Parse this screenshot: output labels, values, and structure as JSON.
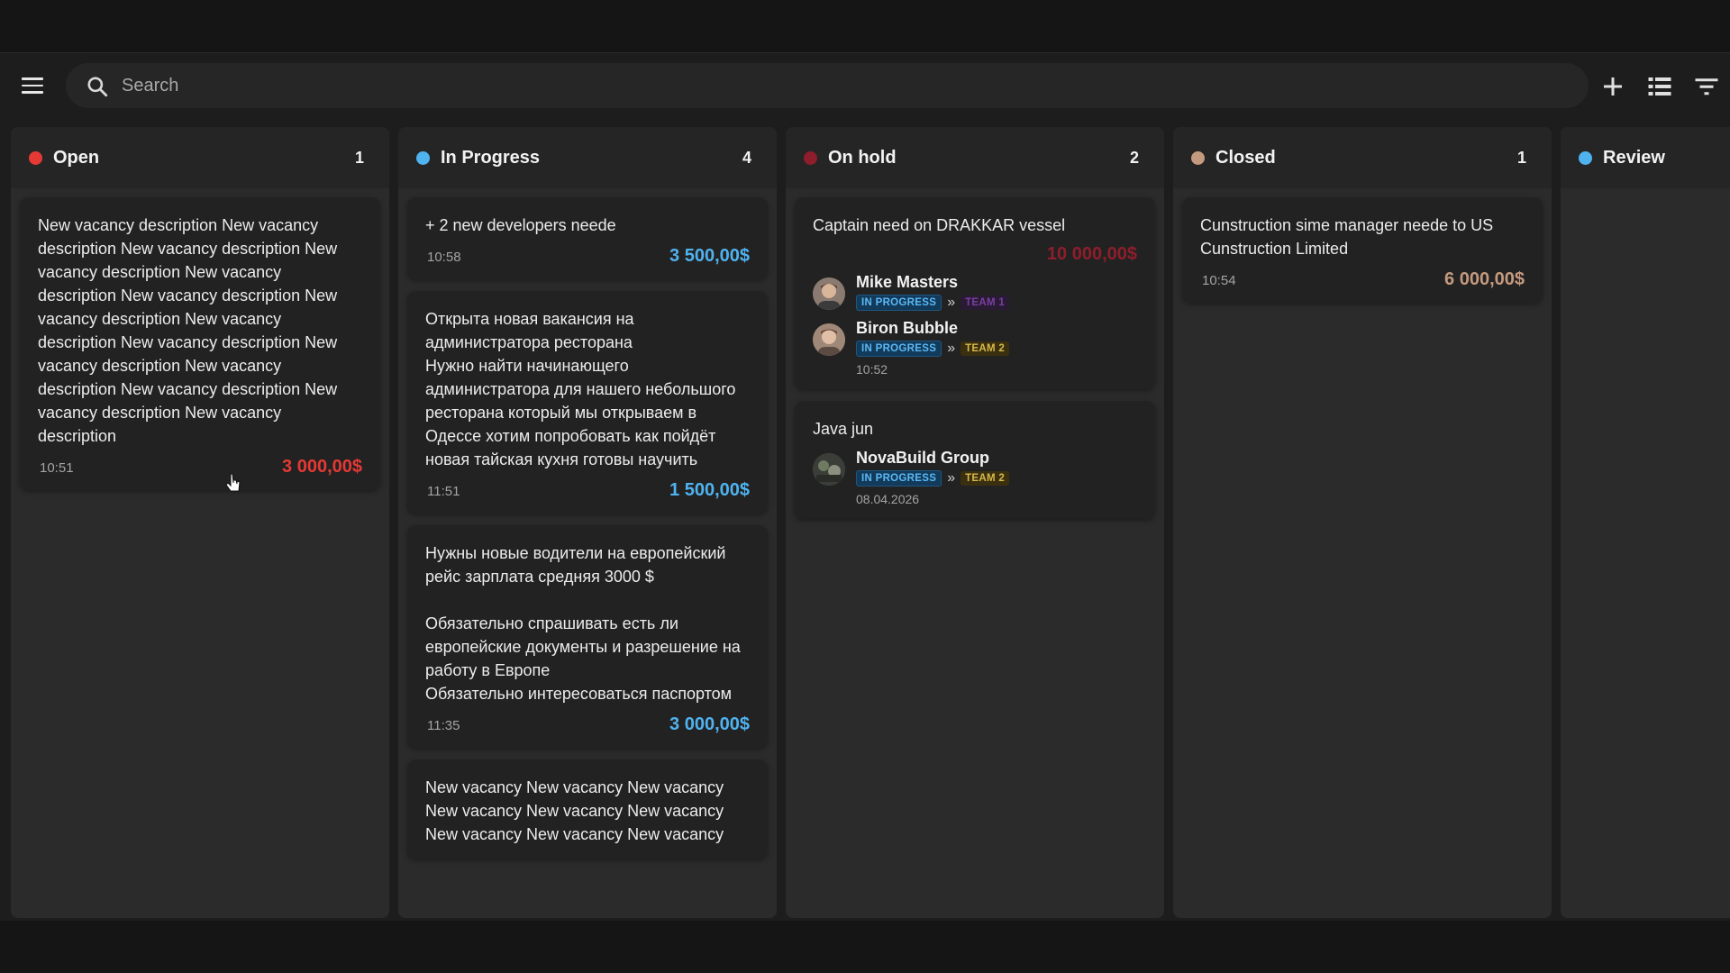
{
  "search": {
    "placeholder": "Search"
  },
  "colors": {
    "open": "#e53935",
    "in_progress": "#4fb3f0",
    "on_hold": "#8e1e2c",
    "closed": "#c49a7e",
    "review": "#4fb3f0"
  },
  "columns": [
    {
      "title": "Open",
      "count": "1",
      "cards": [
        {
          "text": "New vacancy description New vacancy description New vacancy description New vacancy description New vacancy description New vacancy description New vacancy description New vacancy description New vacancy description New vacancy description New vacancy description New vacancy description New vacancy description New vacancy description",
          "time": "10:51",
          "amount": "3 000,00$"
        }
      ]
    },
    {
      "title": "In Progress",
      "count": "4",
      "cards": [
        {
          "text": "+ 2 new developers neede",
          "time": "10:58",
          "amount": "3 500,00$"
        },
        {
          "text": "Открыта новая вакансия на администратора ресторана\nНужно найти начинающего администратора для нашего небольшого ресторана который мы открываем в Одессе хотим попробовать как пойдёт новая тайская кухня готовы научить",
          "time": "11:51",
          "amount": "1 500,00$"
        },
        {
          "text": "Нужны новые водители на европейский рейс зарплата средняя 3000 $\n\nОбязательно спрашивать есть ли европейские документы и разрешение на работу в Европе\nОбязательно интересоваться паспортом",
          "time": "11:35",
          "amount": "3 000,00$"
        },
        {
          "text": "New vacancy New vacancy New vacancy New vacancy New vacancy New vacancy New vacancy New vacancy New vacancy"
        }
      ]
    },
    {
      "title": "On hold",
      "count": "2",
      "cards": [
        {
          "text": "Captain need on DRAKKAR vessel",
          "amount": "10 000,00$",
          "assignees": [
            {
              "name": "Mike Masters",
              "status": "IN PROGRESS",
              "team": "TEAM 1"
            },
            {
              "name": "Biron Bubble",
              "status": "IN PROGRESS",
              "team": "TEAM 2"
            }
          ],
          "time": "10:52"
        },
        {
          "text": "Java jun",
          "assignees": [
            {
              "name": "NovaBuild Group",
              "status": "IN PROGRESS",
              "team": "TEAM 2"
            }
          ],
          "time": "08.04.2026"
        }
      ]
    },
    {
      "title": "Closed",
      "count": "1",
      "cards": [
        {
          "text": "Cunstruction sime manager neede to US Cunstruction Limited",
          "time": "10:54",
          "amount": "6 000,00$"
        }
      ]
    },
    {
      "title": "Review"
    }
  ],
  "chevron": "»"
}
